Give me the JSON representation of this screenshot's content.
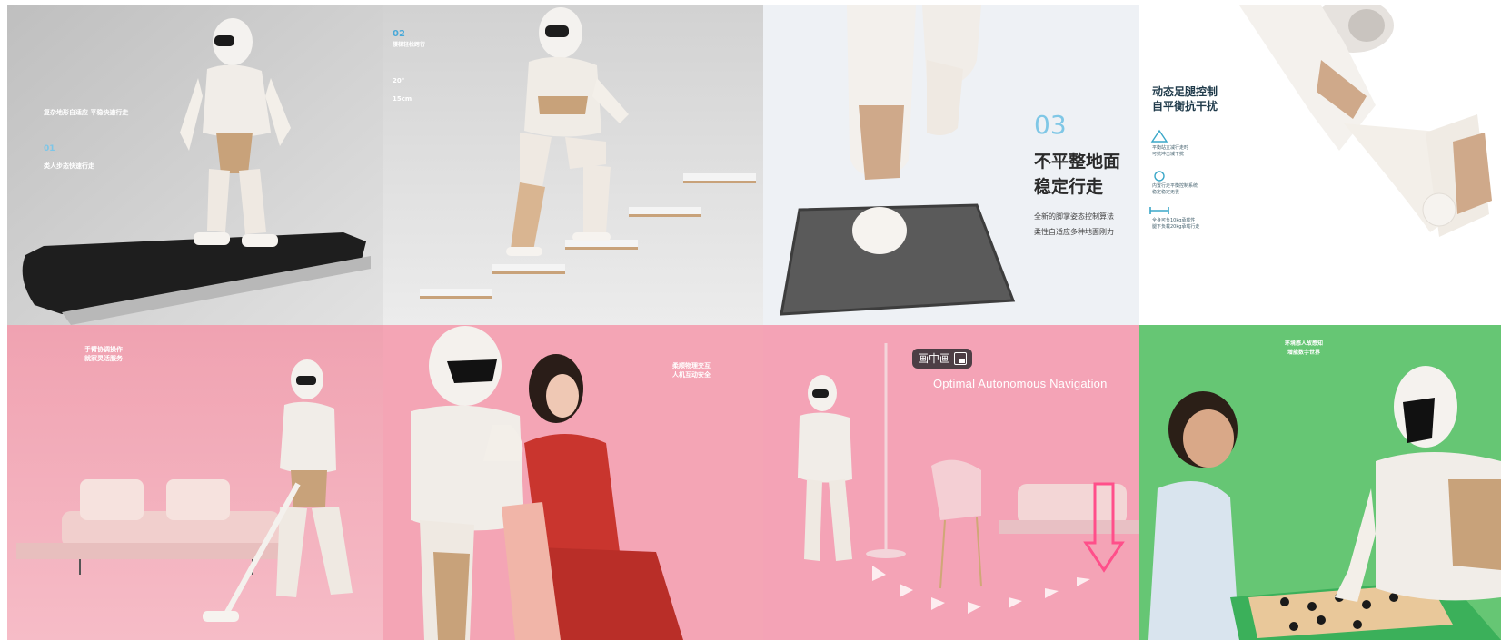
{
  "tiles": [
    {
      "id": "treadmill",
      "head": "复杂地形自适应\n平稳快速行走",
      "sub": "类人步态快速行走",
      "num": "01"
    },
    {
      "id": "stairs",
      "num": "02",
      "head": "楼梯轻松跨行",
      "stat1": "20°",
      "stat2": "15cm"
    },
    {
      "id": "uneven-ground",
      "num": "03",
      "head_line1": "不平整地面",
      "head_line2": "稳定行走",
      "body_line1": "全新的脚掌姿态控制算法",
      "body_line2": "柔性自适应多种地面刚力"
    },
    {
      "id": "leg-control",
      "head_line1": "动态足腿控制",
      "head_line2": "自平衡抗干扰",
      "item1": "平衡站立减行走时\n可抗冲击减干扰",
      "item2": "内置行走平衡控制系统\n稳定稳定无畏",
      "item3": "全身可负10kg承载性\n腿下负载20kg承载行走"
    },
    {
      "id": "vacuum",
      "head": "手臂协调操作\n就家灵活服务"
    },
    {
      "id": "massage",
      "head": "柔顺物理交互\n人机互动安全"
    },
    {
      "id": "navigation",
      "pip_label": "画中画",
      "nav_text": "Optimal Autonomous Navigation"
    },
    {
      "id": "chess",
      "head": "环境感人故感知\n增能数字世界"
    }
  ],
  "colors": {
    "pink": "#f2a6b4",
    "green": "#6dc77a",
    "gold": "#c8a27a",
    "white_body": "#f6f3ef"
  }
}
